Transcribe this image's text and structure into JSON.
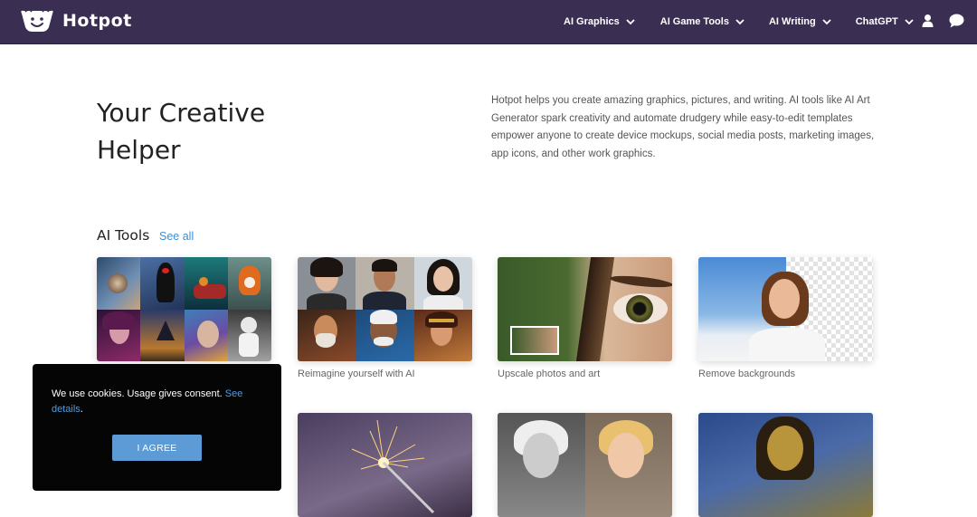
{
  "brand": {
    "name": "Hotpot"
  },
  "nav": {
    "items": [
      {
        "label": "AI Graphics"
      },
      {
        "label": "AI Game Tools"
      },
      {
        "label": "AI Writing"
      },
      {
        "label": "ChatGPT"
      }
    ],
    "icons": [
      "user-icon",
      "chat-icon"
    ]
  },
  "hero": {
    "title_line1": "Your Creative",
    "title_line2": "Helper",
    "description": "Hotpot helps you create amazing graphics, pictures, and writing. AI tools like AI Art Generator spark creativity and automate drudgery while easy-to-edit templates empower anyone to create device mockups, social media posts, marketing images, app icons, and other work graphics."
  },
  "tools": {
    "title": "AI Tools",
    "see_all": "See all",
    "cards": [
      {
        "caption": ""
      },
      {
        "caption": "Reimagine yourself with AI"
      },
      {
        "caption": "Upscale photos and art"
      },
      {
        "caption": "Remove backgrounds"
      }
    ]
  },
  "cookie": {
    "text": "We use cookies. Usage gives consent.",
    "link_see": "See",
    "link_details": "details",
    "period": ".",
    "button": "I AGREE"
  },
  "colors": {
    "nav_bg": "#3a2f52",
    "link": "#3d8ed6",
    "button": "#5c9bd6"
  }
}
